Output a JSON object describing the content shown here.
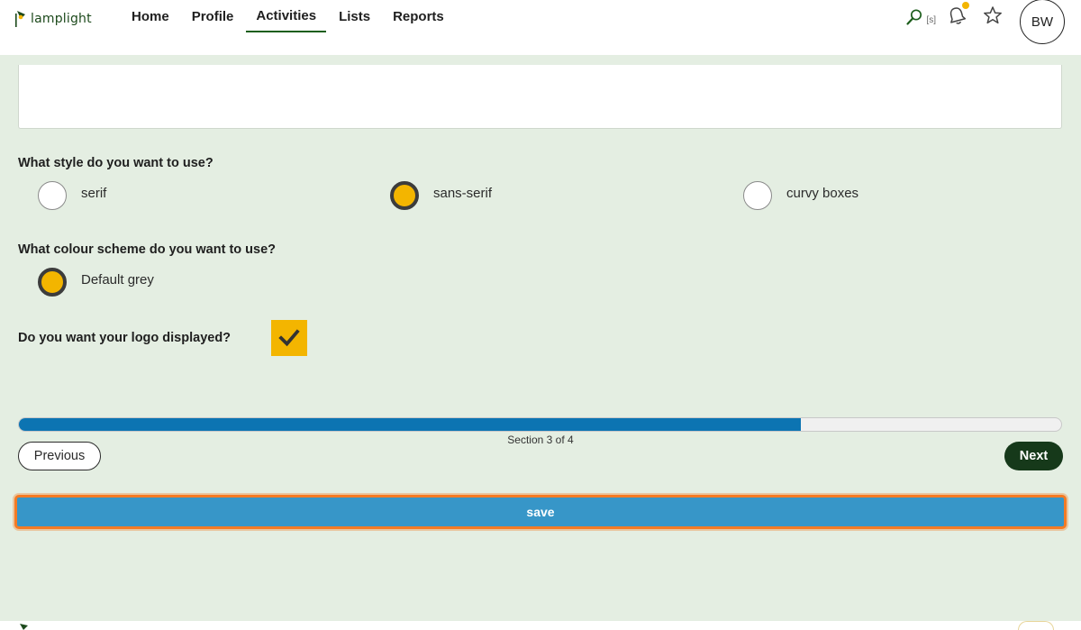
{
  "app": {
    "logo_text": "lamplight"
  },
  "nav": {
    "items": [
      {
        "label": "Home"
      },
      {
        "label": "Profile"
      },
      {
        "label": "Activities"
      },
      {
        "label": "Lists"
      },
      {
        "label": "Reports"
      }
    ],
    "active": "Activities"
  },
  "header": {
    "search_shortcut": "[s]",
    "avatar_initials": "BW",
    "has_notification": true
  },
  "form": {
    "style_question": "What style do you want to use?",
    "style_options": [
      {
        "label": "serif",
        "selected": false
      },
      {
        "label": "sans-serif",
        "selected": true
      },
      {
        "label": "curvy boxes",
        "selected": false
      }
    ],
    "colour_question": "What colour scheme do you want to use?",
    "colour_options": [
      {
        "label": "Default grey",
        "selected": true
      }
    ],
    "logo_question": "Do you want your logo displayed?",
    "logo_checked": true
  },
  "progress": {
    "fraction": 0.75,
    "label": "Section 3 of 4"
  },
  "buttons": {
    "previous": "Previous",
    "next": "Next",
    "save": "save"
  },
  "colors": {
    "accent_yellow": "#f3b500",
    "nav_active": "#1d5e1c",
    "progress_blue": "#0c74b2",
    "save_blue": "#3796c8",
    "focus_orange": "#f47b24",
    "next_green": "#16391a",
    "page_bg": "#e4eee2"
  }
}
